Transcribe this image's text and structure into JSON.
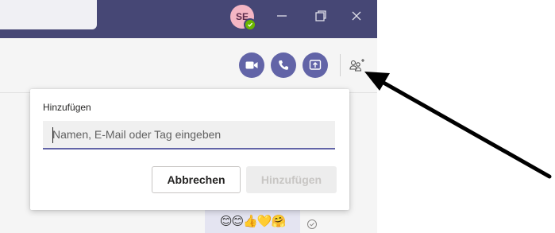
{
  "titlebar": {
    "avatar_initials": "SE",
    "presence_status": "available",
    "window_buttons": [
      "minimize-icon",
      "maximize-icon",
      "close-icon"
    ]
  },
  "toolbar": {
    "actions": [
      "video-call-icon",
      "audio-call-icon",
      "share-screen-icon",
      "add-people-icon"
    ]
  },
  "dialog": {
    "title": "Hinzufügen",
    "input_value": "",
    "input_placeholder": "Namen, E-Mail oder Tag eingeben",
    "cancel_label": "Abbrechen",
    "add_label": "Hinzufügen"
  },
  "chat": {
    "reactions": "😊😊👍💛🤗"
  },
  "colors": {
    "titlebar": "#464775",
    "accent": "#6264a7",
    "presence_available": "#6bb700",
    "avatar_bg": "#f4b6c4",
    "arrow": "#000000"
  }
}
